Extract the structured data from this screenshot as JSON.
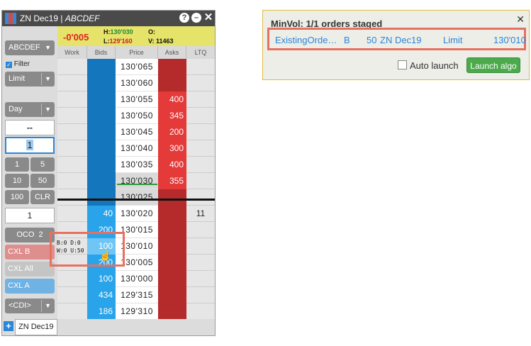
{
  "window": {
    "title": "ZN Dec19",
    "title_account": "ABCDEF",
    "net_change": "-0'005",
    "high_label": "H:",
    "high_value": "130'030",
    "low_label": "L:",
    "low_value": "129'160",
    "open_label": "O:",
    "open_value": "",
    "volume_label": "V:",
    "volume_value": "11463",
    "help_icon": "?",
    "min_icon": "–",
    "close_icon": "✕"
  },
  "left_panel": {
    "account": "ABCDEF",
    "filter_label": "Filter",
    "filter_checked": true,
    "order_type": "Limit",
    "tif": "Day",
    "dash_display": "--",
    "qty_input": "1",
    "qty_buttons": [
      "1",
      "5",
      "10",
      "50",
      "100",
      "CLR"
    ],
    "order_qty": "1",
    "oco_label": "OCO",
    "oco_count": "2",
    "cxl_bids": "CXL B",
    "cxl_all": "CXL All",
    "cxl_asks": "CXL A",
    "cdi": "<CDI>"
  },
  "ladder": {
    "headers": [
      "Work",
      "Bids",
      "Price",
      "Asks",
      "LTQ"
    ],
    "rows": [
      {
        "price": "130'065",
        "bid": "",
        "ask": "",
        "ltq": ""
      },
      {
        "price": "130'060",
        "bid": "",
        "ask": "",
        "ltq": ""
      },
      {
        "price": "130'055",
        "bid": "",
        "ask": "400",
        "ltq": ""
      },
      {
        "price": "130'050",
        "bid": "",
        "ask": "345",
        "ltq": ""
      },
      {
        "price": "130'045",
        "bid": "",
        "ask": "200",
        "ltq": ""
      },
      {
        "price": "130'040",
        "bid": "",
        "ask": "300",
        "ltq": ""
      },
      {
        "price": "130'035",
        "bid": "",
        "ask": "400",
        "ltq": ""
      },
      {
        "price": "130'030",
        "bid": "",
        "ask": "355",
        "ltq": ""
      },
      {
        "price": "130'025",
        "bid": "",
        "ask": "",
        "ltq": ""
      },
      {
        "price": "130'020",
        "bid": "40",
        "ask": "",
        "ltq": "11"
      },
      {
        "price": "130'015",
        "bid": "200",
        "ask": "",
        "ltq": ""
      },
      {
        "price": "130'010",
        "bid": "100",
        "ask": "",
        "ltq": ""
      },
      {
        "price": "130'005",
        "bid": "200",
        "ask": "",
        "ltq": ""
      },
      {
        "price": "130'000",
        "bid": "100",
        "ask": "",
        "ltq": ""
      },
      {
        "price": "129'315",
        "bid": "434",
        "ask": "",
        "ltq": ""
      },
      {
        "price": "129'310",
        "bid": "186",
        "ask": "",
        "ltq": ""
      }
    ],
    "tooltip_line1": "B:0  D:0",
    "tooltip_line2": "W:0  U:50"
  },
  "tabs": {
    "add": "+",
    "active": "ZN Dec19"
  },
  "popup": {
    "title": "MinVol: 1/1 orders staged",
    "close": "✕",
    "order": {
      "name": "ExistingOrde…",
      "side": "B",
      "qty": "50",
      "contract": "ZN Dec19",
      "type": "Limit",
      "price": "130'010"
    },
    "auto_launch_label": "Auto launch",
    "auto_launch_checked": false,
    "launch_button": "Launch algo"
  },
  "colors": {
    "bid": "#1477bd",
    "bid_light": "#29a3ea",
    "ask": "#b52a2a",
    "ask_light": "#e43a3a",
    "info_bar": "#e5e36a",
    "highlight": "#e8705f",
    "launch": "#4ca94c"
  }
}
